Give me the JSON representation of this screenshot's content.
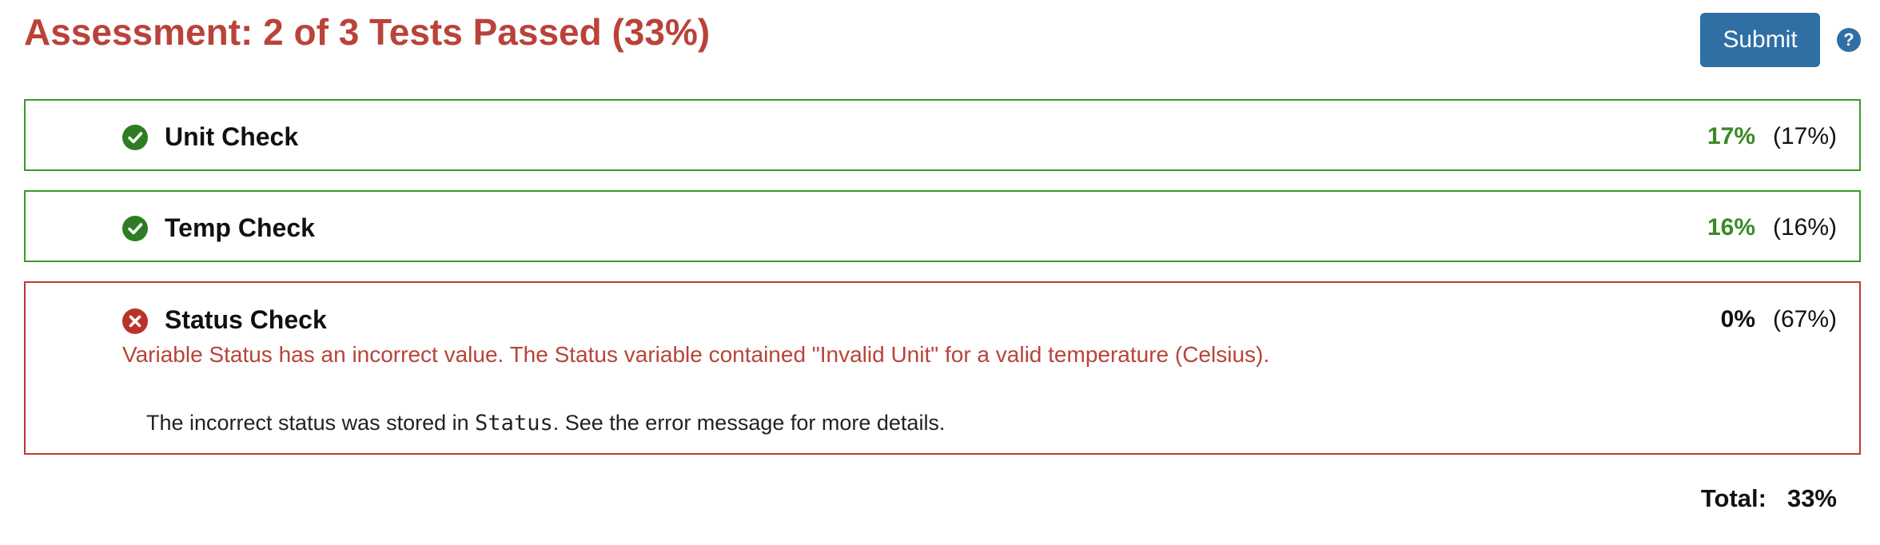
{
  "header": {
    "title": "Assessment: 2 of 3 Tests Passed (33%)",
    "submit_label": "Submit",
    "help_glyph": "?"
  },
  "colors": {
    "title": "#b9433a",
    "submit": "#2f6fa3",
    "pass_border": "#3a9a2a",
    "fail_border": "#c0392b",
    "pass_score": "#3a8a24",
    "error_text": "#b9433a"
  },
  "tests": [
    {
      "name": "Unit Check",
      "status": "pass",
      "icon": "check-circle-icon",
      "score": "17%",
      "weight": "(17%)"
    },
    {
      "name": "Temp Check",
      "status": "pass",
      "icon": "check-circle-icon",
      "score": "16%",
      "weight": "(16%)"
    },
    {
      "name": "Status Check",
      "status": "fail",
      "icon": "x-circle-icon",
      "score": "0%",
      "weight": "(67%)",
      "message": "Variable Status has an incorrect value. The Status variable contained \"Invalid Unit\" for a valid temperature (Celsius).",
      "detail_before": "The incorrect status was stored in ",
      "detail_code": "Status",
      "detail_after": ". See the error message for more details."
    }
  ],
  "total": {
    "label": "Total:",
    "value": "33%"
  }
}
